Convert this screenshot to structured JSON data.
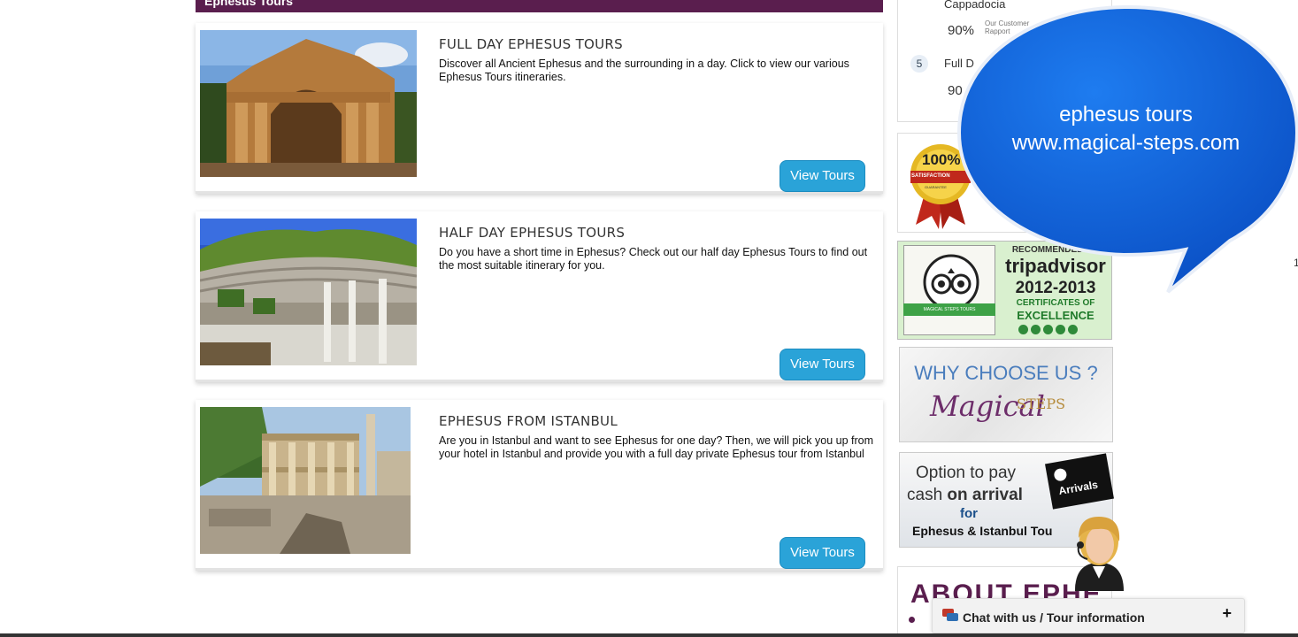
{
  "section": {
    "title": "Ephesus Tours"
  },
  "tours": [
    {
      "title": "FULL DAY EPHESUS TOURS",
      "description": "Discover all Ancient Ephesus and the surrounding in a day. Click to view our various Ephesus Tours itineraries.",
      "button": "View Tours"
    },
    {
      "title": "HALF DAY EPHESUS TOURS",
      "description": "Do you have a short time in Ephesus? Check out our half day Ephesus Tours to find out the most suitable itinerary for you.",
      "button": "View Tours"
    },
    {
      "title": "EPHESUS FROM ISTANBUL",
      "description": "Are you in Istanbul and want to see Ephesus for one day? Then, we will pick you up from your hotel in Istanbul and provide you with a full day private Ephesus tour from Istanbul",
      "button": "View Tours"
    }
  ],
  "sidebar": {
    "rating": {
      "item_top": "Cappadocia",
      "pct_1": "90%",
      "mini_1": "Our Customer",
      "mini_2": "Rapport",
      "rank": "5",
      "item_2": "Full D",
      "pct_2": "90"
    },
    "badge": {
      "value": "100%",
      "label": "SATISFACTION",
      "sub": "GUARANTEE"
    },
    "tripadvisor": {
      "recommended": "RECOMMENDED ON",
      "brand": "tripadvisor",
      "years": "2012-2013",
      "line1": "CERTIFICATES OF",
      "line2": "EXCELLENCE",
      "ribbon": "MAGICAL STEPS TOURS"
    },
    "why": {
      "title": "WHY CHOOSE US ?",
      "logo_main": "Magical",
      "logo_steps": "STEPS"
    },
    "cash": {
      "line1": "Option to pay",
      "line2_plain": "cash ",
      "line2_bold": "on arrival",
      "line3": "for",
      "line4": "Ephesus & Istanbul Tou",
      "arrivals": "Arrivals"
    },
    "about": {
      "heading": "ABOUT EPHE"
    }
  },
  "chat": {
    "label": "Chat with us / Tour information",
    "toggle": "+"
  },
  "bubble": {
    "line1": "ephesus tours",
    "line2": "www.magical-steps.com"
  },
  "edge_mark": "1",
  "colors": {
    "section_bar": "#5a1e4e",
    "button": "#2aa3d8",
    "bubble": "#0b5fd6"
  }
}
